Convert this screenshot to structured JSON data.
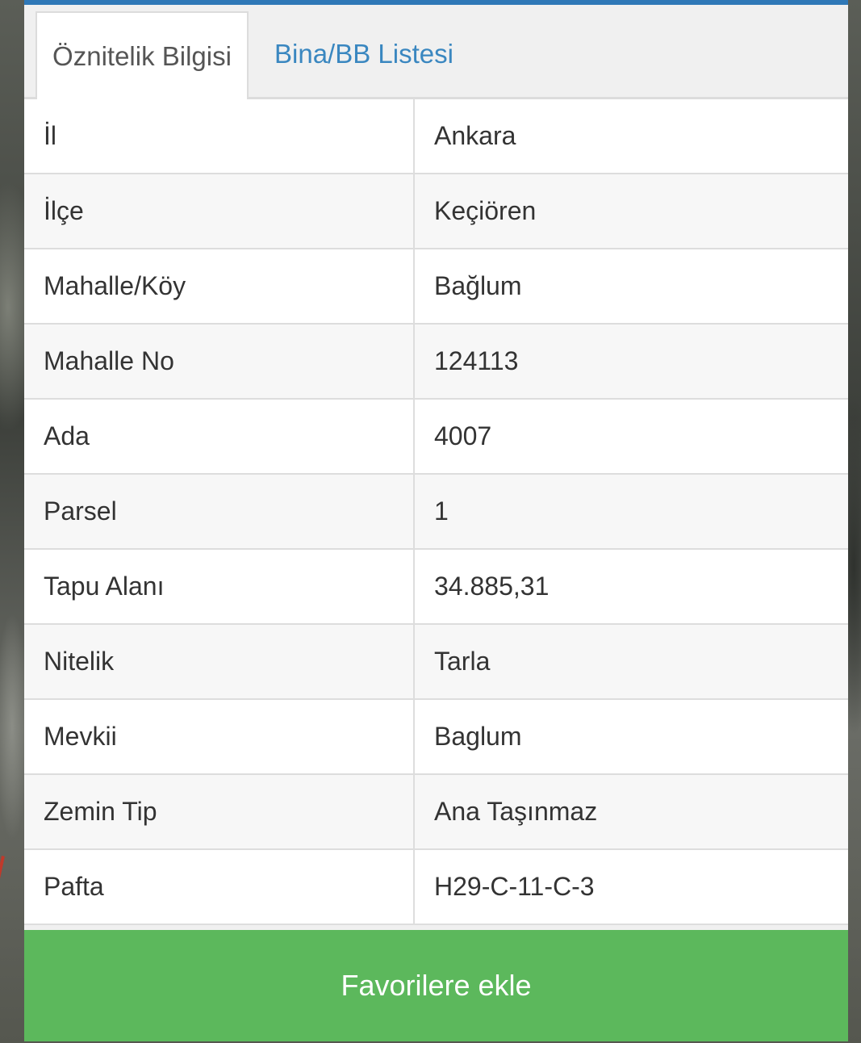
{
  "tabs": [
    {
      "label": "Öznitelik Bilgisi",
      "active": true
    },
    {
      "label": "Bina/BB Listesi",
      "active": false
    }
  ],
  "attributes": [
    {
      "key": "İl",
      "value": "Ankara"
    },
    {
      "key": "İlçe",
      "value": "Keçiören"
    },
    {
      "key": "Mahalle/Köy",
      "value": "Bağlum"
    },
    {
      "key": "Mahalle No",
      "value": "124113"
    },
    {
      "key": "Ada",
      "value": "4007"
    },
    {
      "key": "Parsel",
      "value": "1"
    },
    {
      "key": "Tapu Alanı",
      "value": "34.885,31"
    },
    {
      "key": "Nitelik",
      "value": "Tarla"
    },
    {
      "key": "Mevkii",
      "value": "Baglum"
    },
    {
      "key": "Zemin Tip",
      "value": "Ana Taşınmaz"
    },
    {
      "key": "Pafta",
      "value": "H29-C-11-C-3"
    }
  ],
  "favorite_button": {
    "label": "Favorilere ekle"
  },
  "colors": {
    "accent": "#2f78b7",
    "link": "#3a87c0",
    "button": "#5cb85c"
  }
}
